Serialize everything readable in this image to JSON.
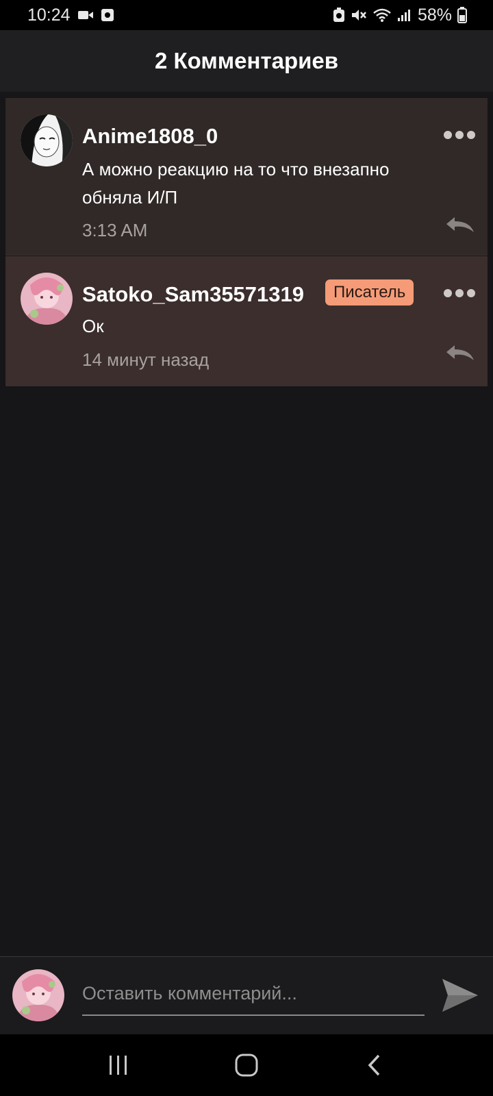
{
  "status_bar": {
    "time": "10:24",
    "battery": "58%"
  },
  "header": {
    "title": "2 Комментариев"
  },
  "comments": [
    {
      "username": "Anime1808_0",
      "text": "А можно реакцию на то что внезапно обняла И/П",
      "timestamp": "3:13 AM",
      "avatar_icon": "avatar-anime"
    },
    {
      "username": "Satoko_Sam35571319",
      "badge": "Писатель",
      "text": "Ок",
      "timestamp": "14 минут назад",
      "avatar_icon": "avatar-satoko"
    }
  ],
  "composer": {
    "placeholder": "Оставить комментарий..."
  },
  "colors": {
    "background": "#161517",
    "header": "#1f1e20",
    "comment_1_bg": "#302927",
    "comment_2_bg": "#3b2e2d",
    "badge": "#f59b77"
  }
}
